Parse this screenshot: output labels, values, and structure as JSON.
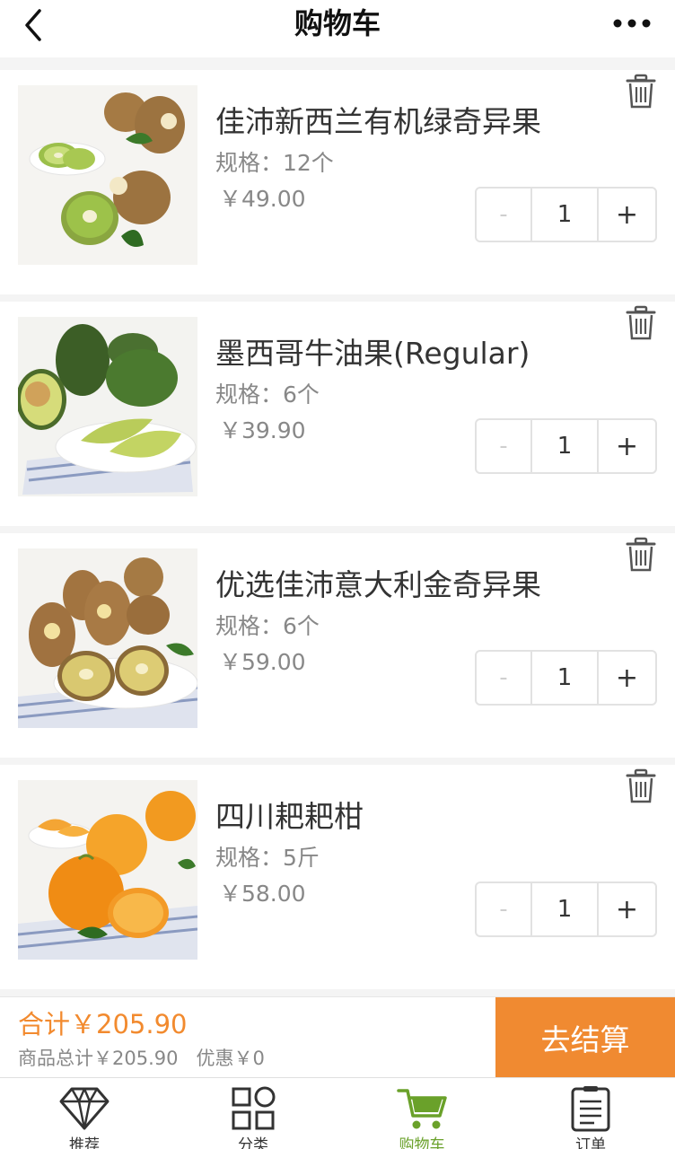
{
  "header": {
    "title": "购物车",
    "back_icon": "chevron-left-icon",
    "more_icon": "more-dots-icon"
  },
  "cart": {
    "items": [
      {
        "name": "佳沛新西兰有机绿奇异果",
        "spec": "规格：12个",
        "price": "￥49.00",
        "qty": "1",
        "minus": "-",
        "plus": "+",
        "image": "green-kiwi-photo"
      },
      {
        "name": "墨西哥牛油果(Regular)",
        "spec": "规格：6个",
        "price": "￥39.90",
        "qty": "1",
        "minus": "-",
        "plus": "+",
        "image": "avocado-photo"
      },
      {
        "name": "优选佳沛意大利金奇异果",
        "spec": "规格：6个",
        "price": "￥59.00",
        "qty": "1",
        "minus": "-",
        "plus": "+",
        "image": "gold-kiwi-photo"
      },
      {
        "name": "四川耙耙柑",
        "spec": "规格：5斤",
        "price": "￥58.00",
        "qty": "1",
        "minus": "-",
        "plus": "+",
        "image": "orange-photo"
      }
    ]
  },
  "summary": {
    "total": "合计￥205.90",
    "detail": "商品总计￥205.90   优惠￥0",
    "checkout_label": "去结算"
  },
  "nav": {
    "items": [
      {
        "label": "推荐",
        "icon": "diamond-icon"
      },
      {
        "label": "分类",
        "icon": "grid-icon"
      },
      {
        "label": "购物车",
        "icon": "cart-icon",
        "active": true
      },
      {
        "label": "订单",
        "icon": "order-list-icon"
      }
    ]
  },
  "colors": {
    "accent": "#f08a31",
    "active_nav": "#6aa12a",
    "price_text": "#888888"
  }
}
